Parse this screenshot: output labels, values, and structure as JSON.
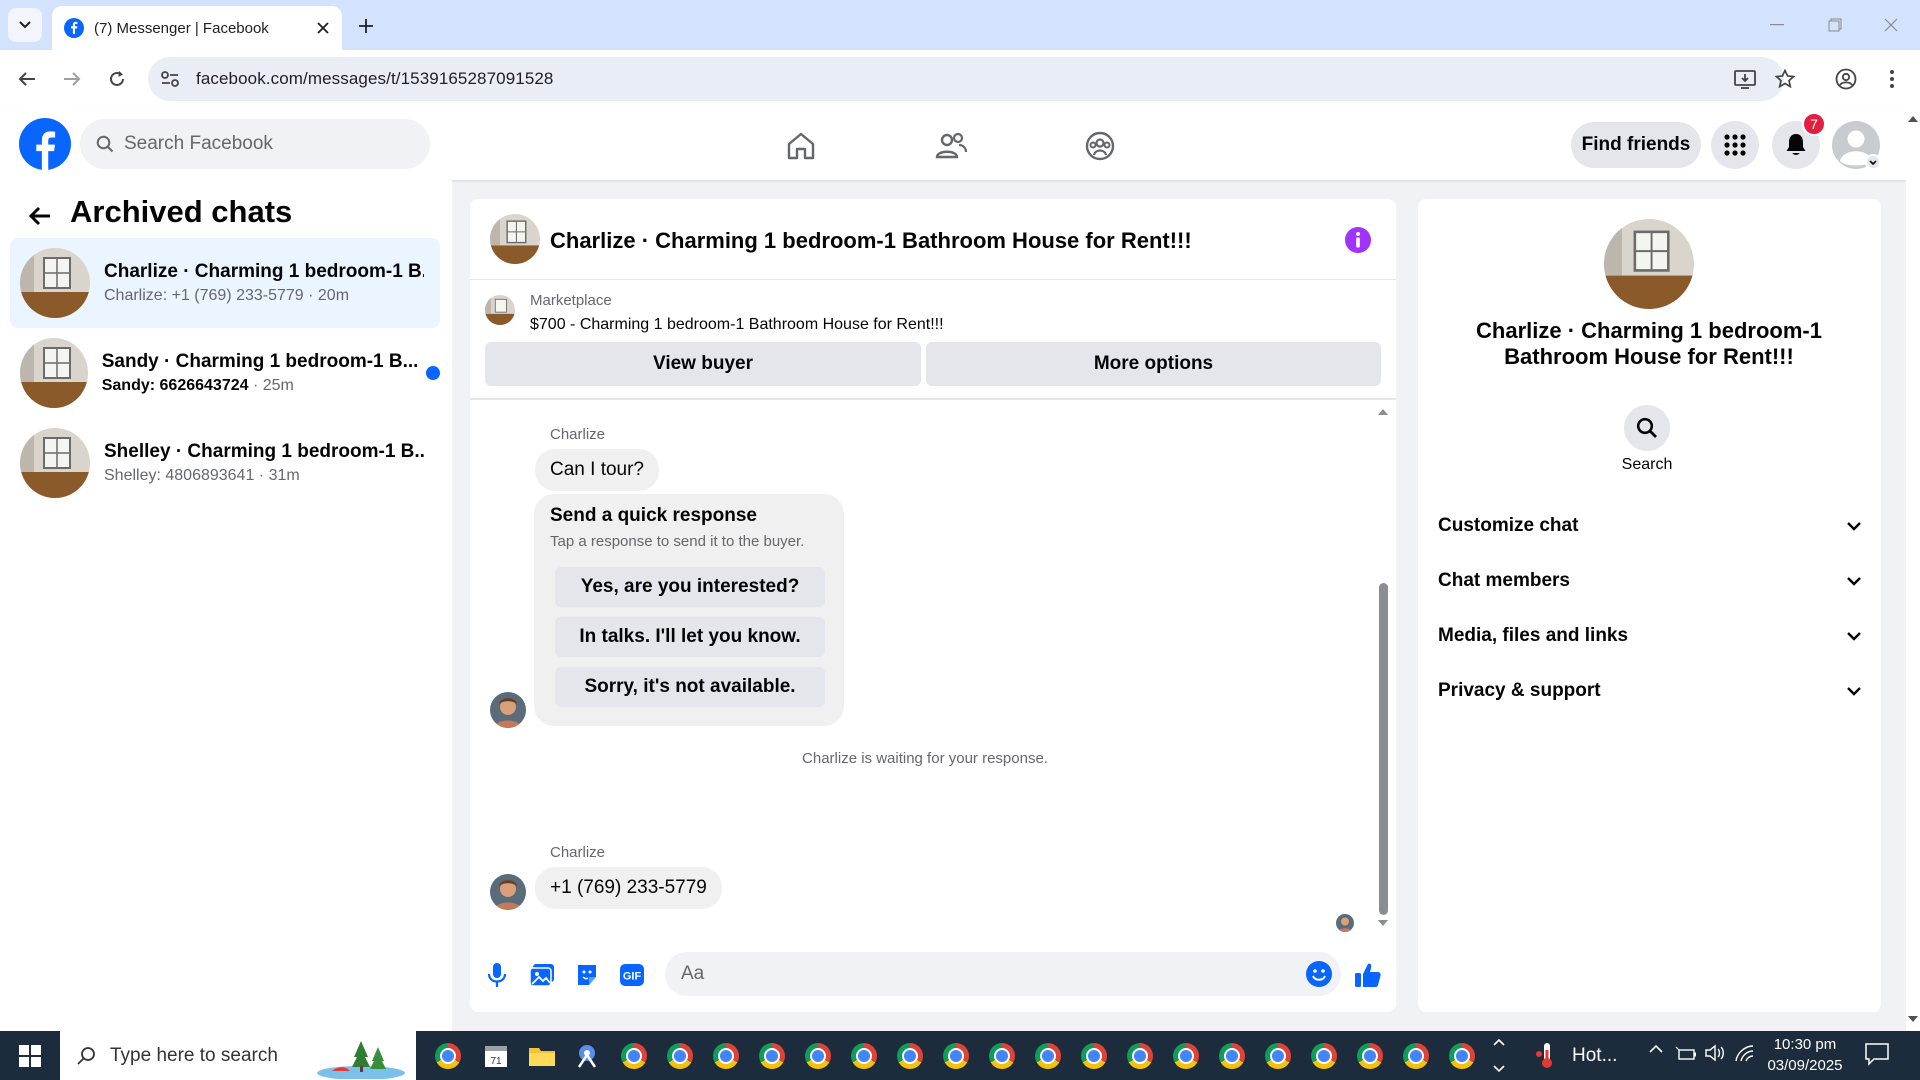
{
  "browser": {
    "tab_title": "(7) Messenger | Facebook",
    "url": "facebook.com/messages/t/1539165287091528"
  },
  "header": {
    "search_placeholder": "Search Facebook",
    "find_friends": "Find friends",
    "notification_count": "7"
  },
  "left_panel": {
    "title": "Archived chats",
    "conversations": [
      {
        "name": "Charlize · Charming 1 bedroom-1 B...",
        "preview": "Charlize: +1 (769) 233-5779",
        "time": "20m",
        "unread": false
      },
      {
        "name": "Sandy · Charming 1 bedroom-1 B...",
        "preview": "Sandy: 6626643724",
        "time": "25m",
        "unread": true
      },
      {
        "name": "Shelley · Charming 1 bedroom-1 B...",
        "preview": "Shelley: 4806893641",
        "time": "31m",
        "unread": false
      }
    ]
  },
  "chat": {
    "title": "Charlize · Charming 1 bedroom-1 Bathroom House for Rent!!!",
    "marketplace_label": "Marketplace",
    "marketplace_item": "$700 - Charming 1 bedroom-1 Bathroom House for Rent!!!",
    "view_buyer": "View buyer",
    "more_options": "More options",
    "messages": [
      {
        "sender": "Charlize",
        "text": "Can I tour?"
      },
      {
        "sender": "Charlize",
        "text": "+1 (769) 233-5779"
      }
    ],
    "quick_response": {
      "title": "Send a quick response",
      "subtitle": "Tap a response to send it to the buyer.",
      "options": [
        "Yes, are you interested?",
        "In talks. I'll let you know.",
        "Sorry, it's not available."
      ]
    },
    "waiting_text": "Charlize is waiting for your response.",
    "composer_placeholder": "Aa"
  },
  "right_panel": {
    "name": "Charlize · Charming 1 bedroom-1 Bathroom House for Rent!!!",
    "search_label": "Search",
    "sections": [
      "Customize chat",
      "Chat members",
      "Media, files and links",
      "Privacy & support"
    ]
  },
  "taskbar": {
    "search_placeholder": "Type here to search",
    "weather": "Hot...",
    "time": "10:30 pm",
    "date": "03/09/2025"
  },
  "colors": {
    "fb_blue": "#0866ff",
    "info_purple": "#a033ff",
    "badge_red": "#e41e3f",
    "active_row": "#ebf5ff"
  }
}
